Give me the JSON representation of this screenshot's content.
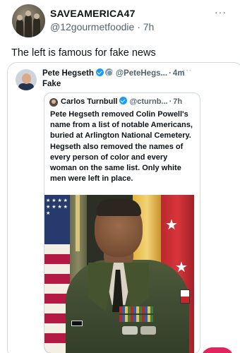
{
  "post": {
    "author_name": "SAVEAMERICA47",
    "author_handle": "@12gourmetfoodie",
    "separator": "·",
    "time": "7h",
    "more": "···",
    "text": "The left is famous for fake news"
  },
  "quote1": {
    "author_name": "Pete Hegseth",
    "author_handle": "@PeteHegs...",
    "separator": "·",
    "time": "4m",
    "more": "···",
    "text": "Fake"
  },
  "quote2": {
    "author_name": "Carlos Turnbull",
    "author_handle": "@cturnb...",
    "separator": "·",
    "time": "7h",
    "text": "Pete Hegseth removed Colin Powell's name from a list of notable Americans, buried at Arlington National Cemetery. Hegseth also removed the names of every person of color and every woman on the same list. Only white men were left in place."
  },
  "colors": {
    "accent": "#1d9bf0",
    "secondary_text": "#536471",
    "border": "#cfd9de",
    "fab": "#e0245e"
  },
  "icons": [
    "more-horizontal-icon",
    "verified-badge-icon",
    "government-badge-icon"
  ]
}
